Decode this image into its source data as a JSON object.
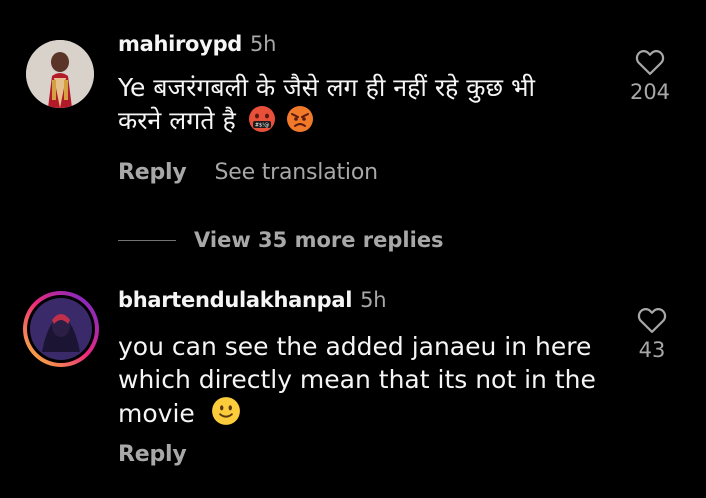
{
  "comments": [
    {
      "username": "mahiroypd",
      "time": "5h",
      "text_line1": "Ye बजरंगबली के जैसे लग ही नहीं रहे कुछ भी",
      "text_line2": "करने लगते है",
      "emojis": [
        "face-with-symbols-on-mouth",
        "angry-face"
      ],
      "likes": "204",
      "reply_label": "Reply",
      "translate_label": "See translation"
    },
    {
      "username": "bhartendulakhanpal",
      "time": "5h",
      "text_line1": "you can see the added janaeu in here",
      "text_line2": "which directly mean that its not in the",
      "text_line3": "movie",
      "emojis": [
        "slightly-smiling-face"
      ],
      "likes": "43",
      "reply_label": "Reply"
    }
  ],
  "view_more_label": "View 35 more replies",
  "icons": {
    "like": "heart-outline-icon"
  },
  "colors": {
    "background": "#000000",
    "primary_text": "#f5f5f5",
    "secondary_text": "#a8a8a8",
    "story_ring_start": "#f9ce34",
    "story_ring_end": "#ee2a7b"
  }
}
